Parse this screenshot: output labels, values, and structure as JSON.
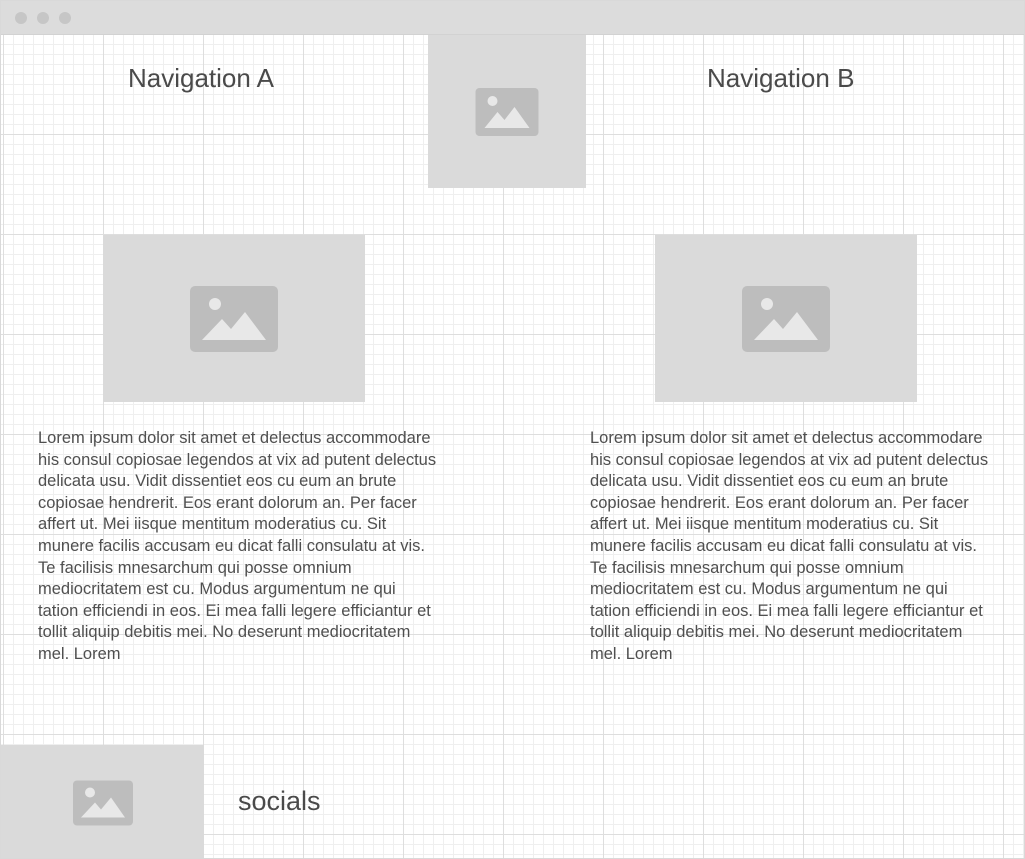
{
  "window": {
    "controls": [
      "close",
      "minimize",
      "maximize"
    ]
  },
  "header": {
    "nav_a": "Navigation A",
    "nav_b": "Navigation B",
    "logo_icon": "image-placeholder-icon"
  },
  "content": {
    "columns": [
      {
        "image_icon": "image-placeholder-icon",
        "text": "Lorem ipsum dolor sit amet et delectus accommodare his consul copiosae legendos at vix ad putent delectus delicata usu. Vidit dissentiet eos cu eum an brute copiosae hendrerit. Eos erant dolorum an. Per facer affert ut. Mei iisque mentitum moderatius cu. Sit munere facilis accusam eu dicat falli consulatu at vis. Te facilisis mnesarchum qui posse omnium mediocritatem est cu. Modus argumentum ne qui tation efficiendi in eos. Ei mea falli legere efficiantur et tollit aliquip debitis mei. No deserunt mediocritatem mel. Lorem"
      },
      {
        "image_icon": "image-placeholder-icon",
        "text": "Lorem ipsum dolor sit amet et delectus accommodare his consul copiosae legendos at vix ad putent delectus delicata usu. Vidit dissentiet eos cu eum an brute copiosae hendrerit. Eos erant dolorum an. Per facer affert ut. Mei iisque mentitum moderatius cu. Sit munere facilis accusam eu dicat falli consulatu at vis. Te facilisis mnesarchum qui posse omnium mediocritatem est cu. Modus argumentum ne qui tation efficiendi in eos. Ei mea falli legere efficiantur et tollit aliquip debitis mei. No deserunt mediocritatem mel. Lorem"
      }
    ]
  },
  "footer": {
    "image_icon": "image-placeholder-icon",
    "socials_label": "socials"
  },
  "colors": {
    "titlebar": "#dcdcdc",
    "placeholder": "#dadada",
    "placeholder_icon": "#bdbdbd",
    "text": "#4a4a4a",
    "grid": "#efefef"
  }
}
